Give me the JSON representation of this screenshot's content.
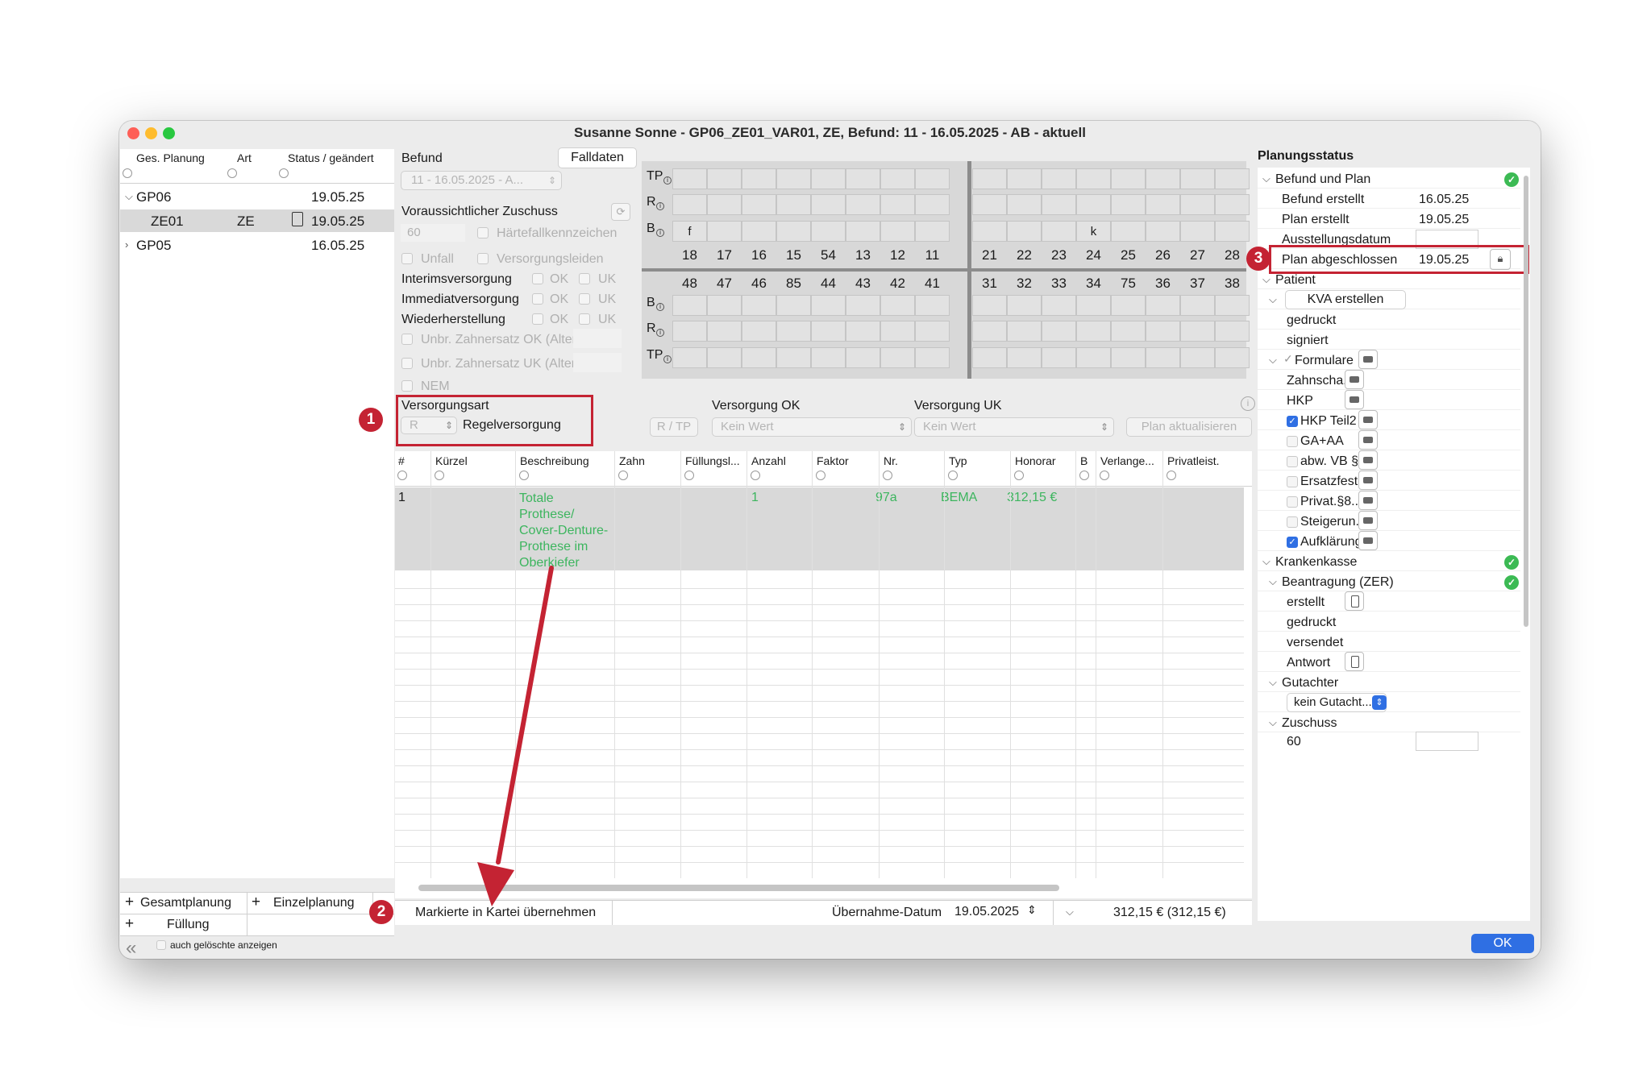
{
  "window": {
    "title": "Susanne Sonne  -  GP06_ZE01_VAR01, ZE, Befund: 11 - 16.05.2025 - AB - aktuell"
  },
  "left": {
    "headers": [
      "Ges. Planung",
      "Art",
      "Status / geändert"
    ],
    "rows": [
      {
        "name": "GP06",
        "art": "",
        "date": "19.05.25"
      },
      {
        "name": "ZE01",
        "art": "ZE",
        "date": "19.05.25"
      },
      {
        "name": "GP05",
        "art": "",
        "date": "16.05.25"
      }
    ],
    "add_gesamt": "Gesamtplanung",
    "add_einzel": "Einzelplanung",
    "add_fuellung": "Füllung",
    "show_deleted": "auch gelöschte anzeigen"
  },
  "befund": {
    "label": "Befund",
    "falldaten": "Falldaten",
    "select_value": "11 - 16.05.2025 - A...",
    "zuschuss_label": "Voraussichtlicher Zuschuss",
    "zuschuss_value": "60",
    "haertefall": "Härtefallkennzeichen",
    "unfall": "Unfall",
    "versorgungsleiden": "Versorgungsleiden",
    "interims": "Interimsversorgung",
    "immediat": "Immediatversorgung",
    "wiederherstellung": "Wiederherstellung",
    "ok": "OK",
    "uk": "UK",
    "unbr_ok": "Unbr. Zahnersatz OK (Alter)",
    "unbr_uk": "Unbr. Zahnersatz UK (Alter)",
    "nem": "NEM",
    "versorgungsart_label": "Versorgungsart",
    "versorgungsart_code": "R",
    "versorgungsart_value": "Regelversorgung"
  },
  "chart": {
    "row_labels_top": [
      "TP",
      "R",
      "B"
    ],
    "row_labels_bottom": [
      "B",
      "R",
      "TP"
    ],
    "upper_left": [
      "18",
      "17",
      "16",
      "15",
      "54",
      "13",
      "12",
      "11"
    ],
    "upper_right": [
      "21",
      "22",
      "23",
      "24",
      "25",
      "26",
      "27",
      "28"
    ],
    "lower_left": [
      "48",
      "47",
      "46",
      "85",
      "44",
      "43",
      "42",
      "41"
    ],
    "lower_right": [
      "31",
      "32",
      "33",
      "34",
      "75",
      "36",
      "37",
      "38"
    ],
    "b_mark_18": "f",
    "b_mark_24": "k"
  },
  "versorgung": {
    "rtp": "R / TP",
    "ok_label": "Versorgung OK",
    "ok_value": "Kein Wert",
    "uk_label": "Versorgung UK",
    "uk_value": "Kein Wert",
    "update": "Plan aktualisieren"
  },
  "table": {
    "columns": [
      "#",
      "Kürzel",
      "Beschreibung",
      "Zahn",
      "Füllungsl...",
      "Anzahl",
      "Faktor",
      "Nr.",
      "Typ",
      "Honorar",
      "B",
      "Verlange...",
      "Privatleist."
    ],
    "row": {
      "num": "1",
      "beschreibung_lines": [
        "Totale",
        "Prothese/",
        "Cover-Denture-",
        "Prothese im",
        "Oberkiefer"
      ],
      "anzahl": "1",
      "nr": "97a",
      "typ": "BEMA",
      "honorar": "312,15 €"
    }
  },
  "bottom": {
    "uebernehmen": "Markierte in Kartei übernehmen",
    "datum_label": "Übernahme-Datum",
    "datum_value": "19.05.2025",
    "total": "312,15 € (312,15 €)",
    "ok_button": "OK"
  },
  "status": {
    "title": "Planungsstatus",
    "befund_plan": "Befund und Plan",
    "befund_erstellt": "Befund erstellt",
    "befund_erstellt_date": "16.05.25",
    "plan_erstellt": "Plan erstellt",
    "plan_erstellt_date": "19.05.25",
    "ausstellungsdatum": "Ausstellungsdatum",
    "plan_abgeschlossen": "Plan abgeschlossen",
    "plan_abgeschlossen_date": "19.05.25",
    "patient": "Patient",
    "kva": "KVA erstellen",
    "gedruckt": "gedruckt",
    "signiert": "signiert",
    "formulare": "Formulare",
    "forms": [
      {
        "label": "Zahnscha...",
        "checkbox": false,
        "checked": false
      },
      {
        "label": "HKP",
        "checkbox": false,
        "checked": false
      },
      {
        "label": "HKP Teil2",
        "checkbox": true,
        "checked": true
      },
      {
        "label": "GA+AA",
        "checkbox": true,
        "checked": false
      },
      {
        "label": "abw. VB §...",
        "checkbox": true,
        "checked": false
      },
      {
        "label": "Ersatzfest....",
        "checkbox": true,
        "checked": false
      },
      {
        "label": "Privat.§8...",
        "checkbox": true,
        "checked": false
      },
      {
        "label": "Steigerun...",
        "checkbox": true,
        "checked": false
      },
      {
        "label": "Aufklärung",
        "checkbox": true,
        "checked": true
      }
    ],
    "krankenkasse": "Krankenkasse",
    "beantragung": "Beantragung (ZER)",
    "erstellt": "erstellt",
    "gedruckt2": "gedruckt",
    "versendet": "versendet",
    "antwort": "Antwort",
    "gutachter": "Gutachter",
    "gutachter_value": "kein Gutacht...",
    "zuschuss": "Zuschuss",
    "zuschuss_value": "60"
  },
  "badges": [
    "1",
    "2",
    "3"
  ],
  "colors": {
    "accent_red": "#c42333",
    "green_text": "#3cb55e",
    "ok_blue": "#2f6fe3"
  }
}
